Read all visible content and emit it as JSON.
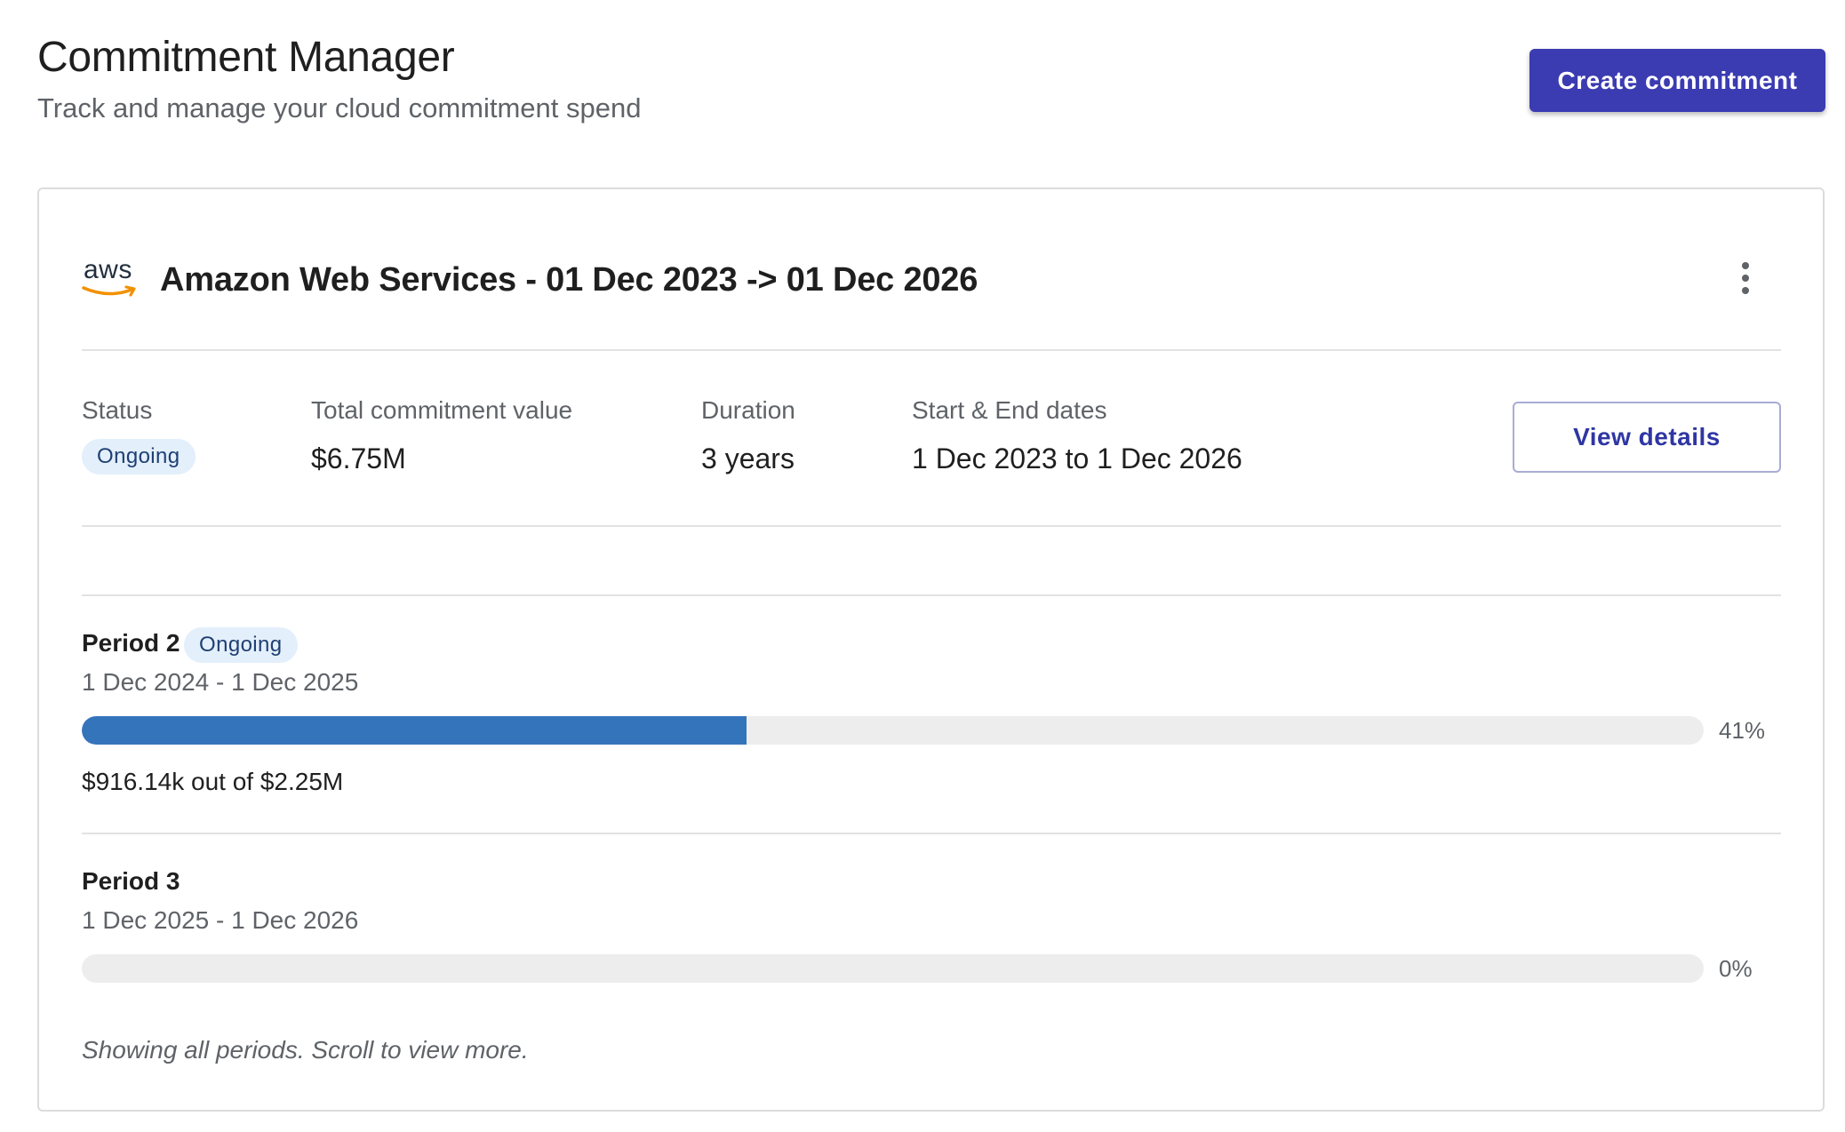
{
  "header": {
    "title": "Commitment Manager",
    "subtitle": "Track and manage your cloud commitment spend",
    "create_button_label": "Create commitment"
  },
  "colors": {
    "primary": "#3b3bb2",
    "progress": "#3474bb",
    "badge_bg": "#e3effb",
    "badge_text": "#1f3f73"
  },
  "commitment": {
    "provider_logo": "aws",
    "provider_icon": "aws-logo-icon",
    "title": "Amazon Web Services - 01 Dec 2023 -> 01 Dec 2026",
    "menu_icon": "kebab-menu-icon",
    "summary": {
      "status_label": "Status",
      "status_value": "Ongoing",
      "total_label": "Total commitment value",
      "total_value": "$6.75M",
      "duration_label": "Duration",
      "duration_value": "3 years",
      "dates_label": "Start & End dates",
      "dates_value": "1 Dec 2023 to 1 Dec 2026"
    },
    "view_details_label": "View details",
    "periods": [
      {
        "name": "Period 2",
        "badge": "Ongoing",
        "dates": "1 Dec 2024 - 1 Dec 2025",
        "progress_percent": 41,
        "progress_label": "41%",
        "amount": "$916.14k out of $2.25M"
      },
      {
        "name": "Period 3",
        "dates": "1 Dec 2025 - 1 Dec 2026",
        "progress_percent": 0,
        "progress_label": "0%"
      }
    ],
    "footnote": "Showing all periods. Scroll to view more."
  }
}
